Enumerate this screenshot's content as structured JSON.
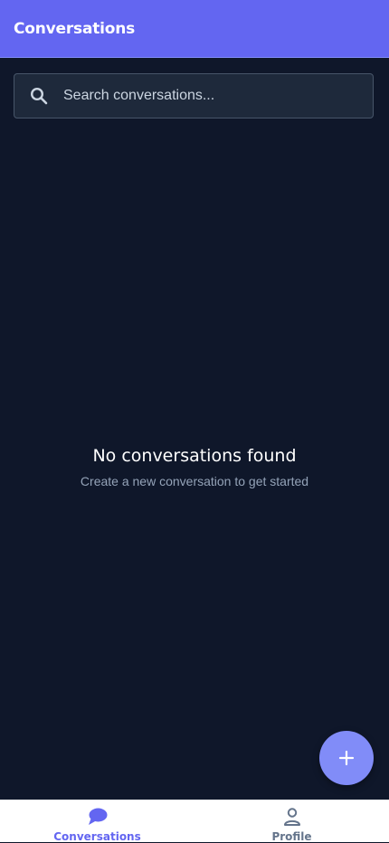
{
  "header": {
    "title": "Conversations"
  },
  "search": {
    "placeholder": "Search conversations...",
    "value": "",
    "icon": "search-icon"
  },
  "empty_state": {
    "title": "No conversations found",
    "subtitle": "Create a new conversation to get started"
  },
  "fab": {
    "icon": "plus-icon"
  },
  "bottom_nav": {
    "items": [
      {
        "label": "Conversations",
        "icon": "chat-bubble-icon",
        "active": true
      },
      {
        "label": "Profile",
        "icon": "person-icon",
        "active": false
      }
    ]
  },
  "colors": {
    "accent": "#6366f1",
    "background": "#0f172a",
    "fab": "#818cf8"
  }
}
